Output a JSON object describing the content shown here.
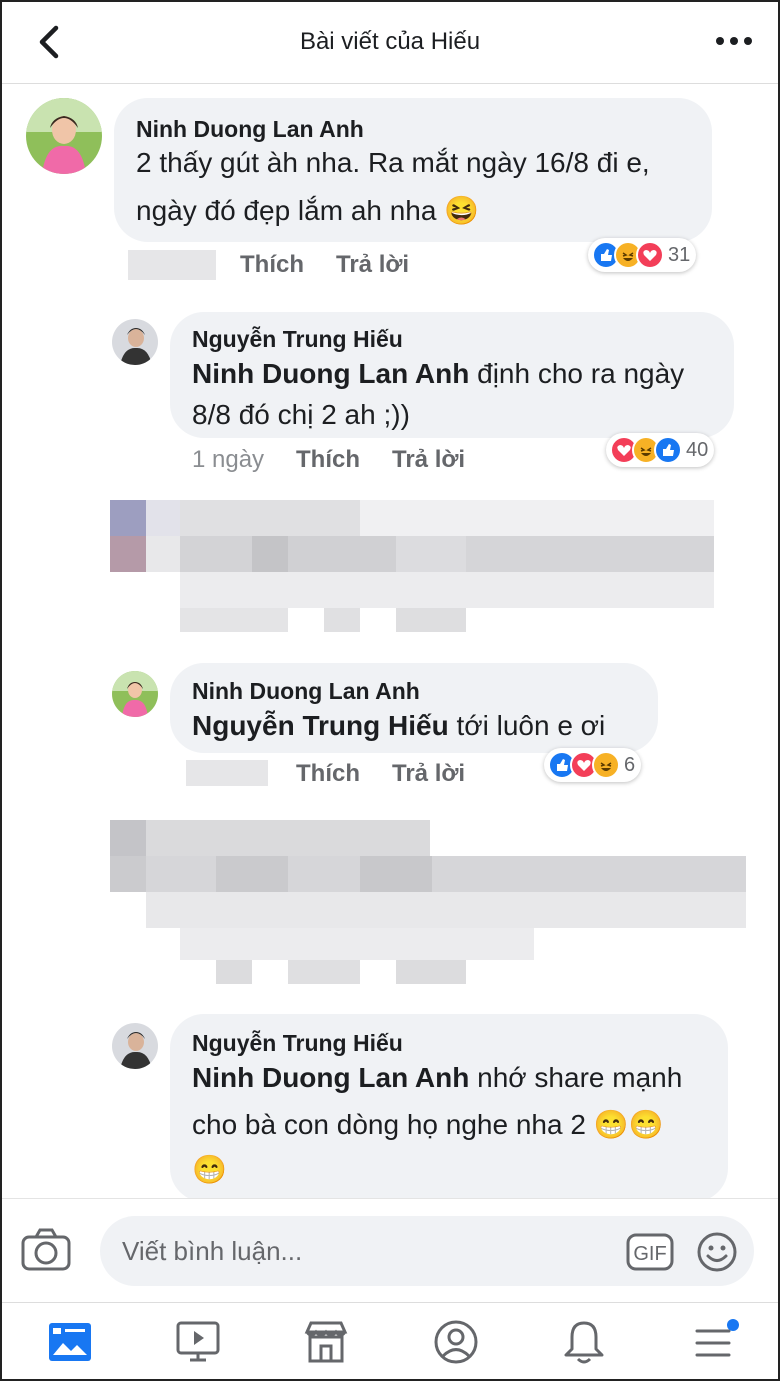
{
  "header": {
    "title": "Bài viết của Hiếu",
    "back_icon": "chevron-left-icon",
    "more_icon": "more-horizontal-icon"
  },
  "comments": [
    {
      "author": "Ninh Duong Lan Anh",
      "line1": "2 thấy gút àh nha. Ra mắt ngày 16/8 đi e,",
      "line2": "ngày đó đẹp lắm ah nha",
      "emoji": "😆",
      "like_label": "Thích",
      "reply_label": "Trả lời",
      "reactions": [
        "like",
        "haha",
        "love"
      ],
      "reaction_count": "31"
    },
    {
      "author": "Nguyễn Trung Hiếu",
      "mention": "Ninh Duong Lan Anh",
      "line1_rest": " định cho ra ngày",
      "line2": "8/8 đó chị 2 ah ;))",
      "time": "1 ngày",
      "like_label": "Thích",
      "reply_label": "Trả lời",
      "reactions": [
        "love",
        "haha",
        "like"
      ],
      "reaction_count": "40"
    },
    {
      "author": "Ninh Duong Lan Anh",
      "mention": "Nguyễn Trung Hiếu",
      "line1_rest": "  tới luôn e ơi",
      "like_label": "Thích",
      "reply_label": "Trả lời",
      "reactions": [
        "like",
        "love",
        "haha"
      ],
      "reaction_count": "6"
    },
    {
      "author": "Nguyễn Trung Hiếu",
      "mention": "Ninh Duong Lan Anh",
      "line1_rest": " nhớ share mạnh",
      "line2": "cho bà con dòng họ nghe nha 2",
      "emoji_line2": "😁😁",
      "emoji_line3": "😁"
    }
  ],
  "composer": {
    "placeholder": "Viết bình luận...",
    "gif_label": "GIF",
    "camera_icon": "camera-icon",
    "emoji_icon": "smiley-icon"
  },
  "tabbar": {
    "items": [
      "news-feed-icon",
      "watch-icon",
      "marketplace-icon",
      "profile-icon",
      "notifications-icon",
      "menu-icon"
    ],
    "active": "news-feed-icon"
  },
  "colors": {
    "accent": "#1877f2",
    "bubble": "#f0f2f5",
    "love": "#f33e58",
    "haha": "#f7b125"
  }
}
